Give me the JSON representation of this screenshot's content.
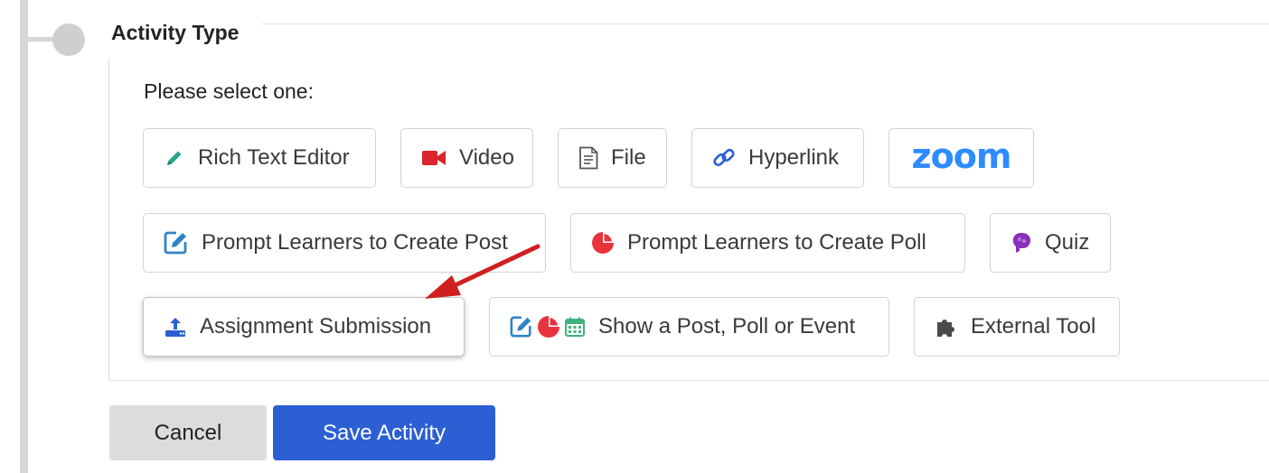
{
  "section": {
    "legend": "Activity Type",
    "prompt": "Please select one:"
  },
  "options": {
    "rich_text_editor": "Rich Text Editor",
    "video": "Video",
    "file": "File",
    "hyperlink": "Hyperlink",
    "zoom": "zoom",
    "prompt_post": "Prompt Learners to Create Post",
    "prompt_poll": "Prompt Learners to Create Poll",
    "quiz": "Quiz",
    "assignment_submission": "Assignment Submission",
    "show_post_poll_event": "Show a Post, Poll or Event",
    "external_tool": "External Tool"
  },
  "actions": {
    "cancel": "Cancel",
    "save": "Save Activity"
  },
  "icons": {
    "rich_text_editor": "pencil-icon",
    "video": "video-camera-icon",
    "file": "document-icon",
    "hyperlink": "link-icon",
    "zoom": "zoom-logo",
    "prompt_post": "edit-square-icon",
    "prompt_poll": "pie-chart-icon",
    "quiz": "brain-icon",
    "assignment_submission": "upload-icon",
    "show_post_poll_event": "post-poll-calendar-icons",
    "external_tool": "puzzle-icon",
    "annotation": "red-arrow"
  },
  "colors": {
    "accent_blue": "#2b5fd3",
    "zoom_blue": "#2d8cff",
    "pencil_teal": "#2aa58c",
    "video_red": "#d8262c",
    "poll_red": "#e8333d",
    "quiz_purple": "#8a2fb8",
    "calendar_green": "#3fb47a",
    "arrow_red": "#d01f1f"
  },
  "state": {
    "selected_option": "Assignment Submission"
  }
}
